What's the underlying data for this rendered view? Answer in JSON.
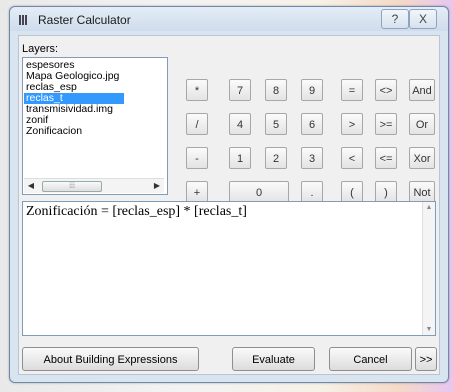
{
  "window": {
    "title": "Raster Calculator",
    "help_icon": "?",
    "close_icon": "X"
  },
  "layers": {
    "label": "Layers:",
    "items": [
      "espesores",
      "Mapa Geologico.jpg",
      "reclas_esp",
      "reclas_t",
      "transmisividad.img",
      "zonif",
      "Zonificacion"
    ],
    "selected_index": 3
  },
  "keypad": {
    "operators": [
      "*",
      "/",
      "-",
      "+"
    ],
    "digits": [
      "7",
      "8",
      "9",
      "4",
      "5",
      "6",
      "1",
      "2",
      "3",
      "0",
      "."
    ],
    "comparison": [
      "=",
      "<>",
      ">",
      ">=",
      "<",
      "<=",
      "(",
      ")"
    ],
    "logical": [
      "And",
      "Or",
      "Xor",
      "Not"
    ]
  },
  "expression": {
    "text": "Zonificación = [reclas_esp] * [reclas_t]"
  },
  "buttons": {
    "about": "About Building Expressions",
    "evaluate": "Evaluate",
    "cancel": "Cancel",
    "more": ">>"
  },
  "colors": {
    "titlebar": "#cfdcec",
    "selection": "#3399ff",
    "client": "#f0f0f0"
  }
}
